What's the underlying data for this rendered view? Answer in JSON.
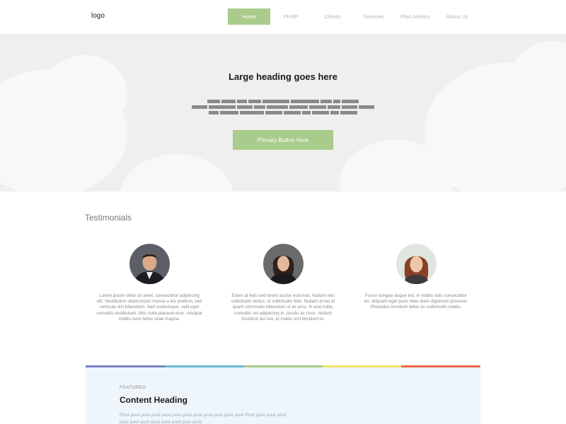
{
  "header": {
    "logo": "logo",
    "nav": [
      {
        "label": "Home",
        "active": true
      },
      {
        "label": "PHSP",
        "active": false
      },
      {
        "label": "Clients",
        "active": false
      },
      {
        "label": "Services",
        "active": false
      },
      {
        "label": "Plan Admins",
        "active": false
      },
      {
        "label": "About Us",
        "active": false
      }
    ]
  },
  "hero": {
    "title": "Large heading goes here",
    "primary_button": "Primary Button Here"
  },
  "testimonials": {
    "title": "Testimonials",
    "items": [
      {
        "text": "Lorem ipsum dolor sit amet, consectetur adipiscing elit. Vestibulum ullamcorper massa a leo pretium, sed vehicula nisl bibendum. Sed scelerisque, velit eget convallis vestibulum, felis nulla placerat eros, volutpat mattis nunc tellus vitae magna."
      },
      {
        "text": "Etiam at felis sed lorem auctor euismod. Nullam nec sollicitudin lectus, ut sollicitudin felis. Nullam at leo et quam commodo bibendum ut ac arcu. In erat nulla, convallis vel adipiscing in, iaculis ac risus. Nullam tincidunt dui nisi, id mattis orci tincidunt id."
      },
      {
        "text": "Fusce congue augue est, in mattis odio consectetur eu. Aliquam eget justo vitae diam dignissim posuere. Phasellus tincidunt tellus eu sollicitudin mattis."
      }
    ]
  },
  "featured": {
    "label": "FEATURED",
    "heading": "Content Heading",
    "body": "Post post post post post post post post post post post post Post post post post post post post post post post post post"
  },
  "colors": {
    "accent": "#a9cb8b",
    "rainbow": [
      "#7b82c6",
      "#67b9cf",
      "#a9cb8b",
      "#f2e06b",
      "#ec6a4a"
    ]
  }
}
